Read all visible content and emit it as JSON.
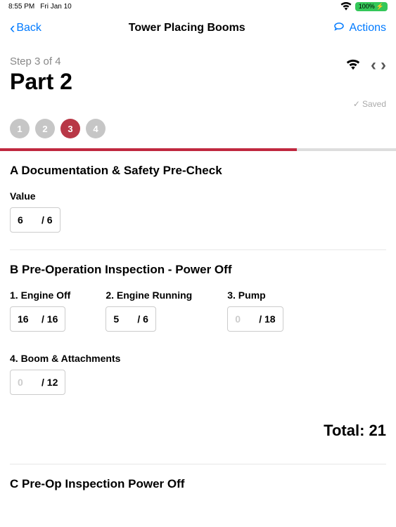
{
  "status": {
    "time": "8:55 PM",
    "date": "Fri Jan 10",
    "wifi": "wifi-icon",
    "battery_pct": "100%"
  },
  "nav": {
    "back_label": "Back",
    "title": "Tower Placing Booms",
    "actions_label": "Actions"
  },
  "header": {
    "step_label": "Step 3 of 4",
    "part_title": "Part 2",
    "saved_label": "Saved"
  },
  "steps": {
    "items": [
      "1",
      "2",
      "3",
      "4"
    ],
    "active_index": 2,
    "progress_pct": 75
  },
  "sectionA": {
    "title": "A Documentation & Safety Pre-Check",
    "value_label": "Value",
    "value": "6",
    "max": "/ 6"
  },
  "sectionB": {
    "title": "B Pre-Operation Inspection - Power Off",
    "fields": [
      {
        "label": "1. Engine Off",
        "value": "16",
        "max": "/ 16",
        "empty": false
      },
      {
        "label": "2. Engine Running",
        "value": "5",
        "max": "/ 6",
        "empty": false
      },
      {
        "label": "3. Pump",
        "value": "0",
        "max": "/ 18",
        "empty": true
      },
      {
        "label": "4. Boom & Attachments",
        "value": "0",
        "max": "/ 12",
        "empty": true
      }
    ],
    "total_label": "Total: 21"
  },
  "sectionC": {
    "title": "C Pre-Op Inspection Power Off"
  }
}
